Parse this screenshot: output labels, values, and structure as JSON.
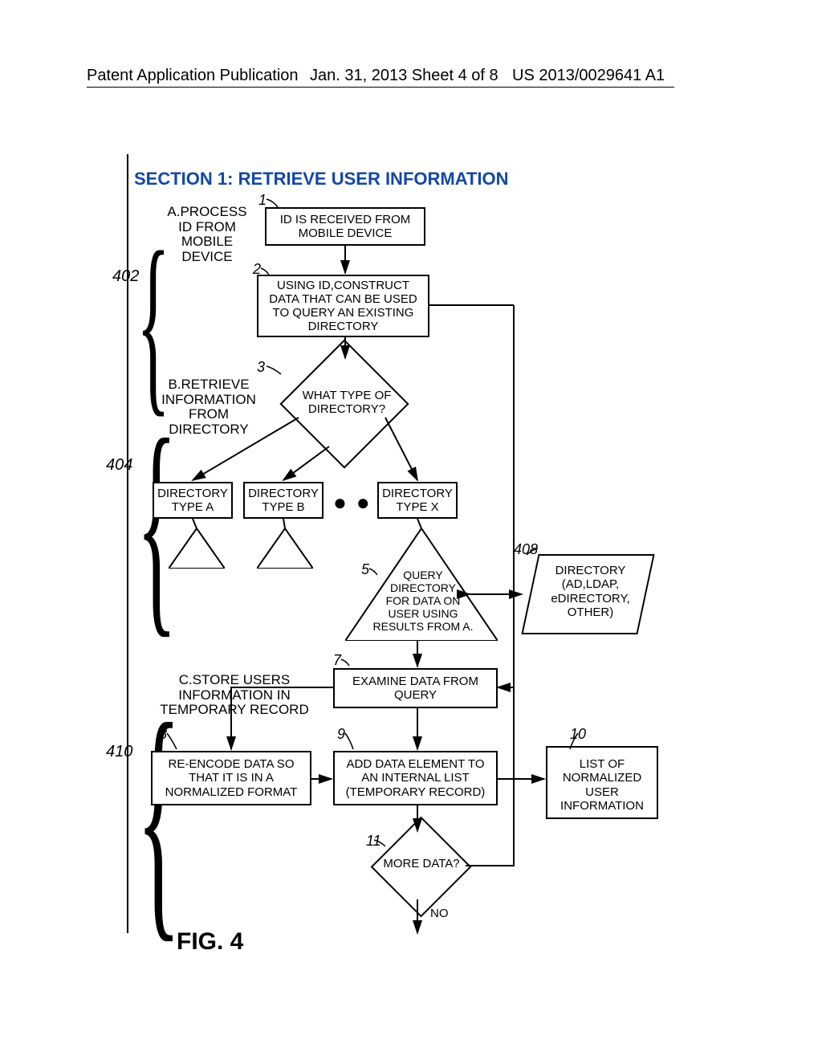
{
  "header": {
    "left": "Patent Application Publication",
    "center": "Jan. 31, 2013  Sheet 4 of 8",
    "right": "US 2013/0029641 A1"
  },
  "section_title": "SECTION 1: RETRIEVE USER INFORMATION",
  "refs": {
    "r402": "402",
    "r404": "404",
    "r408": "408",
    "r410": "410"
  },
  "step_nums": {
    "n1": "1",
    "n2": "2",
    "n3": "3",
    "n5": "5",
    "n7": "7",
    "n8": "8",
    "n9": "9",
    "n10": "10",
    "n11": "11"
  },
  "group_labels": {
    "a": "A.PROCESS\nID FROM\nMOBILE\nDEVICE",
    "b": "B.RETRIEVE\nINFORMATION\nFROM\nDIRECTORY",
    "c": "C.STORE USERS\nINFORMATION IN\nTEMPORARY RECORD"
  },
  "boxes": {
    "step1": "ID IS RECEIVED FROM\nMOBILE DEVICE",
    "step2": "USING ID,CONSTRUCT\nDATA THAT CAN BE\nUSED TO QUERY AN\nEXISTING DIRECTORY",
    "dirA": "DIRECTORY\nTYPE A",
    "dirB": "DIRECTORY\nTYPE B",
    "dirX": "DIRECTORY\nTYPE X",
    "step7": "EXAMINE DATA FROM\nQUERY",
    "step8": "RE-ENCODE DATA SO\nTHAT IT IS IN A\nNORMALIZED FORMAT",
    "step9": "ADD DATA ELEMENT\nTO AN INTERNAL LIST\n(TEMPORARY RECORD)",
    "step10": "LIST OF\nNORMALIZED\nUSER\nINFORMATION"
  },
  "decisions": {
    "d3": "WHAT TYPE OF\nDIRECTORY?",
    "d11": "MORE DATA?",
    "d11_no": "NO"
  },
  "triangle5": "QUERY\nDIRECTORY\nFOR DATA ON\nUSER USING\nRESULTS FROM A.",
  "dir_store": "DIRECTORY\n(AD,LDAP,\n eDIRECTORY,\nOTHER)",
  "ellipsis": "● ● ●",
  "chart_data": {
    "type": "flowchart",
    "title": "SECTION 1: RETRIEVE USER INFORMATION",
    "groups": [
      {
        "id": "402",
        "label": "A.PROCESS ID FROM MOBILE DEVICE",
        "steps": [
          1,
          2
        ]
      },
      {
        "id": "404",
        "label": "B.RETRIEVE INFORMATION FROM DIRECTORY",
        "steps": [
          3,
          "dirTypes",
          5
        ]
      },
      {
        "id": "410",
        "label": "C.STORE USERS INFORMATION IN TEMPORARY RECORD",
        "steps": [
          7,
          8,
          9,
          10,
          11
        ]
      }
    ],
    "nodes": [
      {
        "id": 1,
        "shape": "process",
        "text": "ID IS RECEIVED FROM MOBILE DEVICE"
      },
      {
        "id": 2,
        "shape": "process",
        "text": "USING ID,CONSTRUCT DATA THAT CAN BE USED TO QUERY AN EXISTING DIRECTORY"
      },
      {
        "id": 3,
        "shape": "decision",
        "text": "WHAT TYPE OF DIRECTORY?"
      },
      {
        "id": "dirA",
        "shape": "process",
        "text": "DIRECTORY TYPE A"
      },
      {
        "id": "dirB",
        "shape": "process",
        "text": "DIRECTORY TYPE B"
      },
      {
        "id": "dirX",
        "shape": "process",
        "text": "DIRECTORY TYPE X"
      },
      {
        "id": 5,
        "shape": "triangle",
        "text": "QUERY DIRECTORY FOR DATA ON USER USING RESULTS FROM A."
      },
      {
        "id": 408,
        "shape": "data",
        "text": "DIRECTORY (AD,LDAP, eDIRECTORY, OTHER)"
      },
      {
        "id": 7,
        "shape": "process",
        "text": "EXAMINE DATA FROM QUERY"
      },
      {
        "id": 8,
        "shape": "process",
        "text": "RE-ENCODE DATA SO THAT IT IS IN A NORMALIZED FORMAT"
      },
      {
        "id": 9,
        "shape": "process",
        "text": "ADD DATA ELEMENT TO AN INTERNAL LIST (TEMPORARY RECORD)"
      },
      {
        "id": 10,
        "shape": "storage",
        "text": "LIST OF NORMALIZED USER INFORMATION"
      },
      {
        "id": 11,
        "shape": "decision",
        "text": "MORE DATA?"
      }
    ],
    "edges": [
      [
        1,
        2
      ],
      [
        2,
        3
      ],
      [
        3,
        "dirA"
      ],
      [
        3,
        "dirB"
      ],
      [
        3,
        "dirX"
      ],
      [
        "dirA",
        "triA"
      ],
      [
        "dirB",
        "triB"
      ],
      [
        "dirX",
        5
      ],
      [
        5,
        408,
        "bidir"
      ],
      [
        5,
        7
      ],
      [
        7,
        8,
        "left"
      ],
      [
        8,
        9
      ],
      [
        9,
        10
      ],
      [
        9,
        11
      ],
      [
        11,
        7,
        "loop-yes"
      ],
      [
        11,
        "exit",
        "NO"
      ]
    ]
  },
  "figure_label": "FIG. 4"
}
